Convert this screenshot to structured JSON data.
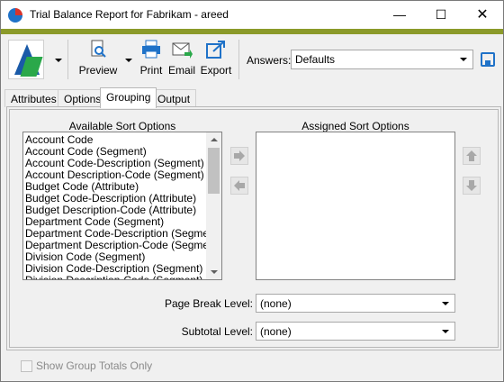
{
  "window": {
    "title": "Trial Balance Report for Fabrikam - areed"
  },
  "toolbar": {
    "preview_label": "Preview",
    "print_label": "Print",
    "email_label": "Email",
    "export_label": "Export",
    "answers_label": "Answers:",
    "answers_value": "Defaults"
  },
  "tabs": [
    "Attributes",
    "Options",
    "Grouping",
    "Output"
  ],
  "active_tab": "Grouping",
  "grouping": {
    "available_label": "Available Sort Options",
    "assigned_label": "Assigned Sort Options",
    "available_items": [
      "Account Code",
      "Account Code (Segment)",
      "Account Code-Description (Segment)",
      "Account Description-Code (Segment)",
      "Budget Code (Attribute)",
      "Budget Code-Description (Attribute)",
      "Budget Description-Code (Attribute)",
      "Department Code (Segment)",
      "Department Code-Description (Segment)",
      "Department Description-Code (Segment)",
      "Division Code (Segment)",
      "Division Code-Description (Segment)",
      "Division Description-Code (Segment)"
    ],
    "assigned_items": [],
    "page_break_label": "Page Break Level:",
    "page_break_value": "(none)",
    "subtotal_label": "Subtotal Level:",
    "subtotal_value": "(none)",
    "show_group_totals_label": "Show Group Totals Only",
    "show_group_totals_checked": false
  },
  "colors": {
    "accent_bar": "#8b9a2a",
    "icon_blue": "#1f72c8",
    "logo_green": "#2aa84a"
  }
}
